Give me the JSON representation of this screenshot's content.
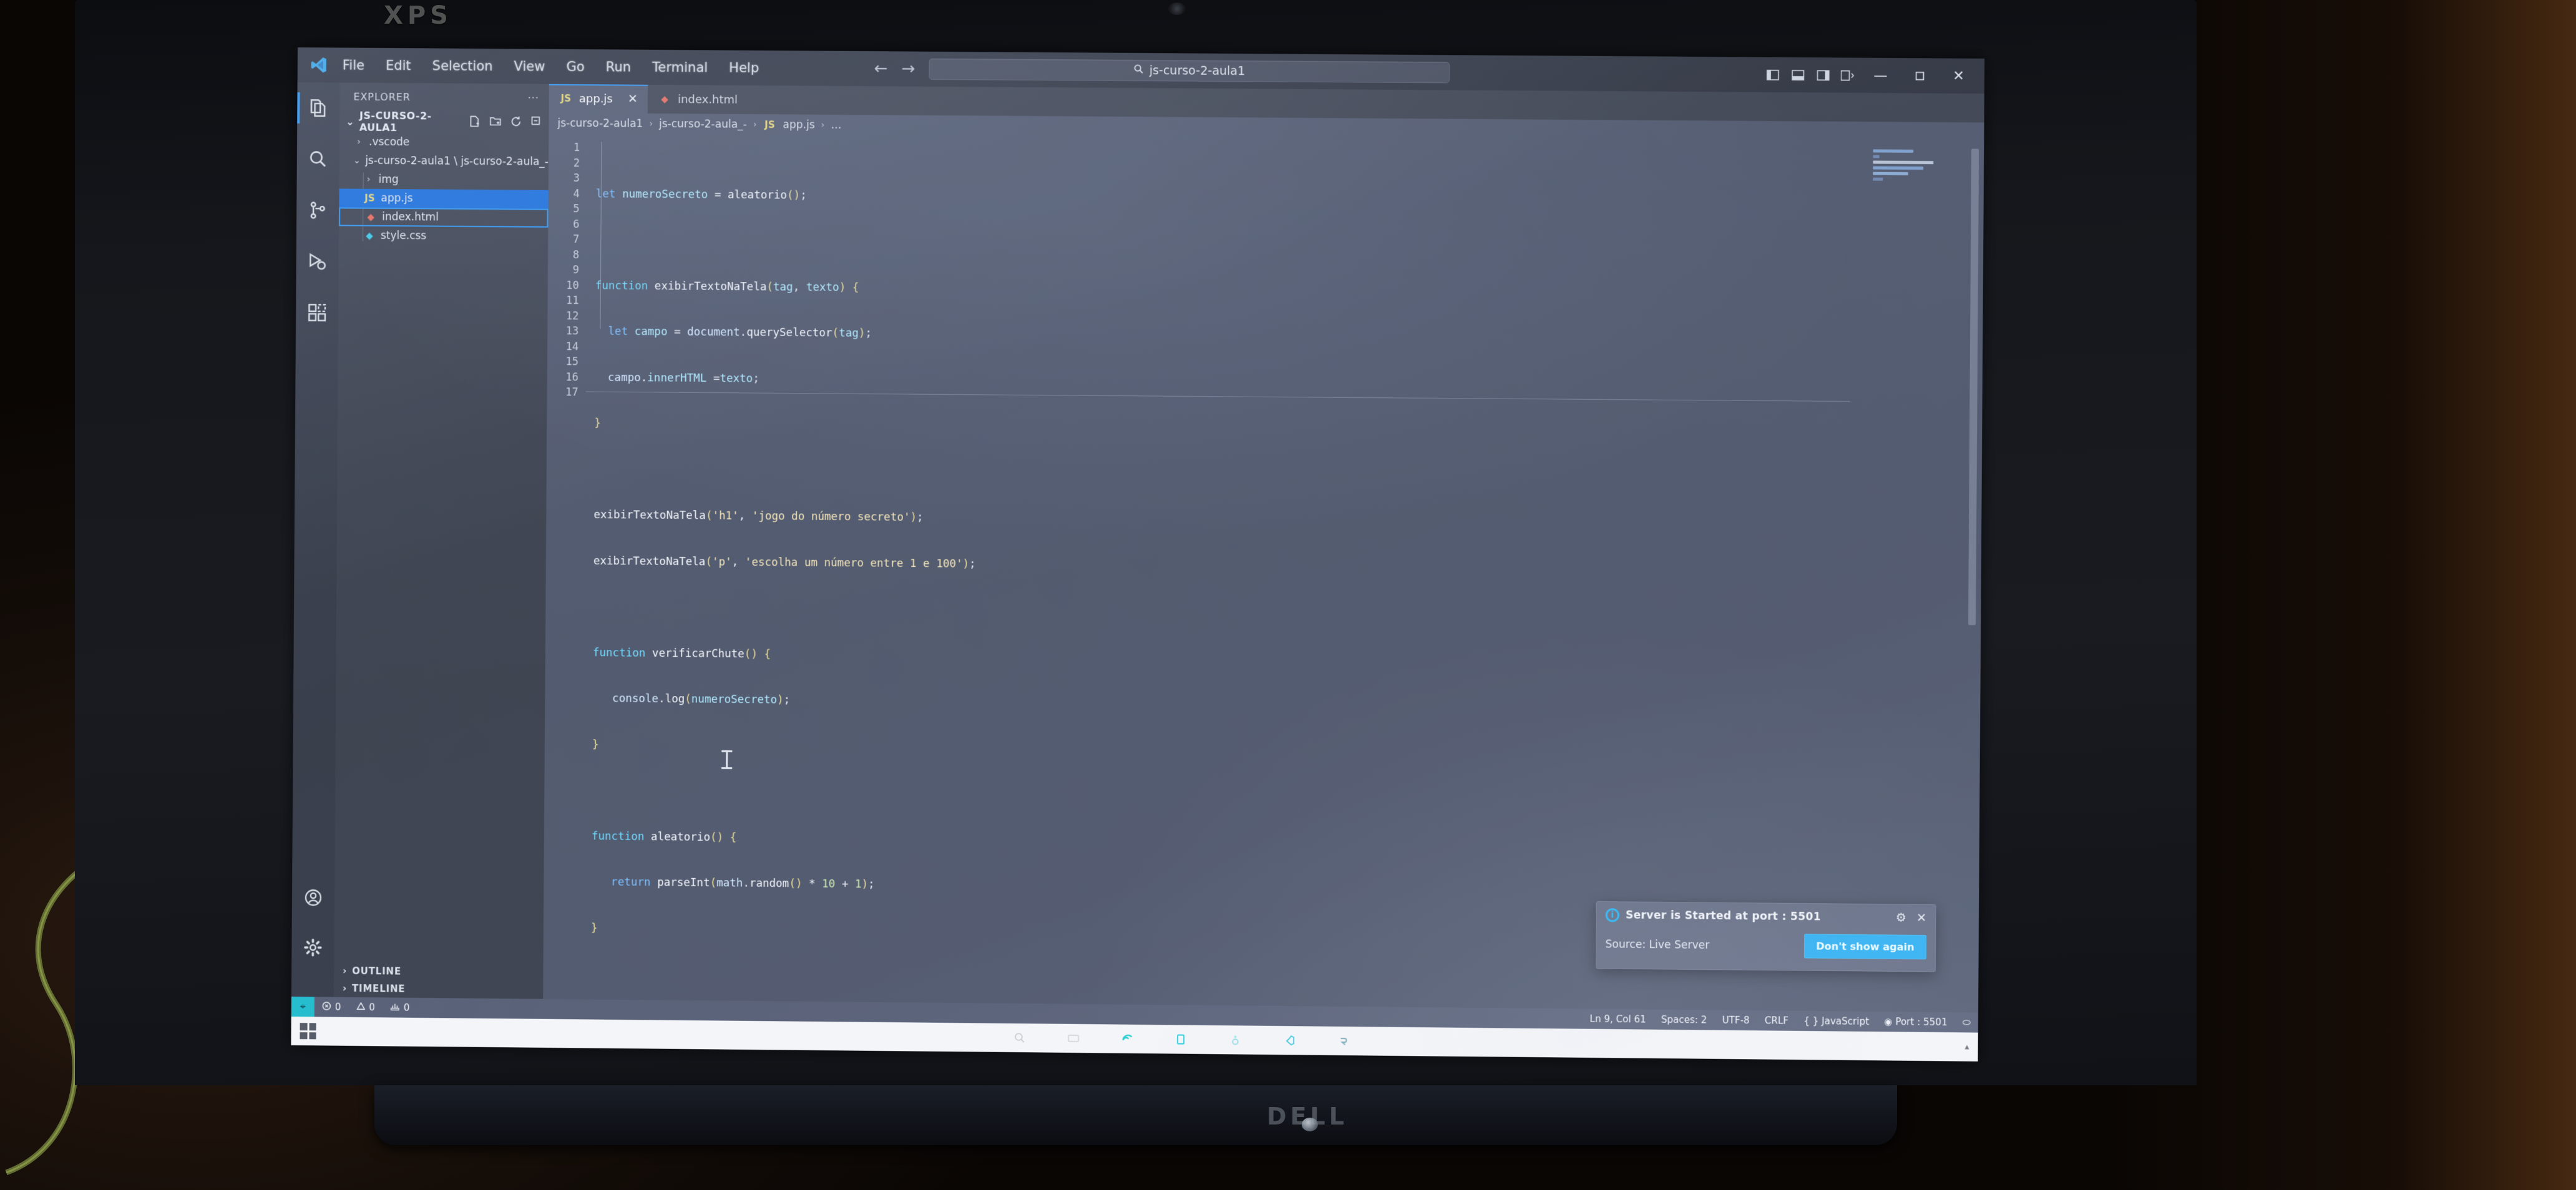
{
  "hardware": {
    "lid_brand": "XPS",
    "chin_brand": "DELL"
  },
  "titlebar": {
    "app_icon": "vscode-logo-icon",
    "menus": [
      "File",
      "Edit",
      "Selection",
      "View",
      "Go",
      "Run",
      "Terminal",
      "Help"
    ],
    "nav_back": "←",
    "nav_forward": "→",
    "command_center_value": "js-curso-2-aula1",
    "command_center_icon": "search-icon",
    "layout_buttons": [
      "toggle-primary-sidebar-icon",
      "toggle-panel-icon",
      "toggle-secondary-sidebar-icon",
      "customize-layout-icon"
    ],
    "window_minimize": "—",
    "window_maximize": "❐",
    "window_close": "✕"
  },
  "activitybar": {
    "items": [
      {
        "name": "explorer",
        "icon": "files-icon",
        "active": true
      },
      {
        "name": "search",
        "icon": "search-icon",
        "active": false
      },
      {
        "name": "source-control",
        "icon": "source-control-icon",
        "active": false
      },
      {
        "name": "run-and-debug",
        "icon": "run-debug-icon",
        "active": false
      },
      {
        "name": "extensions",
        "icon": "extensions-icon",
        "active": false
      }
    ],
    "bottom": [
      {
        "name": "accounts",
        "icon": "account-icon"
      },
      {
        "name": "manage",
        "icon": "gear-icon"
      }
    ]
  },
  "sidebar": {
    "header_title": "EXPLORER",
    "header_more": "···",
    "root_label": "JS-CURSO-2-AULA1",
    "root_chevron": "⌄",
    "root_actions": [
      "new-file-icon",
      "new-folder-icon",
      "refresh-icon",
      "collapse-all-icon"
    ],
    "tree": [
      {
        "label": ".vscode",
        "type": "folder",
        "chevron": "›",
        "depth": 1,
        "state": "normal"
      },
      {
        "label": "js-curso-2-aula1 \\ js-curso-2-aula_-",
        "type": "folder",
        "chevron": "⌄",
        "depth": 1,
        "state": "normal"
      },
      {
        "label": "img",
        "type": "folder",
        "chevron": "›",
        "depth": 2,
        "state": "normal"
      },
      {
        "label": "app.js",
        "type": "js",
        "icon_text": "JS",
        "depth": 2,
        "state": "selected"
      },
      {
        "label": "index.html",
        "type": "html",
        "icon_text": "◆",
        "depth": 2,
        "state": "focused"
      },
      {
        "label": "style.css",
        "type": "css",
        "icon_text": "◆",
        "depth": 2,
        "state": "normal"
      }
    ],
    "sections": [
      {
        "label": "OUTLINE",
        "chevron": "›"
      },
      {
        "label": "TIMELINE",
        "chevron": "›"
      }
    ]
  },
  "editor": {
    "tabs": [
      {
        "label": "app.js",
        "icon_text": "JS",
        "icon_kind": "js",
        "active": true,
        "close": "✕"
      },
      {
        "label": "index.html",
        "icon_text": "◆",
        "icon_kind": "html",
        "active": false,
        "close": ""
      }
    ],
    "breadcrumb": [
      "js-curso-2-aula1",
      "js-curso-2-aula_-",
      "app.js",
      "…"
    ],
    "breadcrumb_file_icon": "JS",
    "breadcrumb_sep": "›",
    "line_numbers": [
      1,
      2,
      3,
      4,
      5,
      6,
      7,
      8,
      9,
      10,
      11,
      12,
      13,
      14,
      15,
      16,
      17
    ],
    "code_lines": [
      "let numeroSecreto = aleatorio();",
      "",
      "function exibirTextoNaTela(tag, texto) {",
      "    let campo = document.querySelector(tag);",
      "    campo.innerHTML =texto;",
      "}",
      "",
      "exibirTextoNaTela('h1', 'jogo do número secreto');",
      "exibirTextoNaTela('p', 'escolha um número entre 1 e 100');",
      "",
      "function verificarChute() {",
      "    console.log(numeroSecreto);",
      "}",
      "",
      "function aleatorio() {",
      "    return parseInt(math.random() * 10 + 1);",
      "}"
    ]
  },
  "toast": {
    "icon": "info-icon",
    "title": "Server is Started at port : 5501",
    "source_label": "Source: Live Server",
    "gear": "⚙",
    "close": "✕",
    "button_label": "Don't show again"
  },
  "statusbar": {
    "remote_label": "⌖",
    "problems": [
      {
        "icon": "error-icon",
        "count": "0"
      },
      {
        "icon": "warning-icon",
        "count": "0"
      },
      {
        "icon": "ports-icon",
        "count": "0"
      }
    ],
    "right_items": [
      {
        "name": "cursor-position",
        "label": "Ln 9, Col 61"
      },
      {
        "name": "indentation",
        "label": "Spaces: 2"
      },
      {
        "name": "encoding",
        "label": "UTF-8"
      },
      {
        "name": "eol",
        "label": "CRLF"
      },
      {
        "name": "language-mode",
        "label": "{ } JavaScript"
      },
      {
        "name": "live-server-port",
        "label": "◉ Port : 5501"
      },
      {
        "name": "notifications",
        "label": "⬭"
      }
    ]
  },
  "taskbar": {
    "start_icon": "windows-start-icon",
    "icons": [
      "search-icon",
      "task-view-icon",
      "edge-icon",
      "file-explorer-icon",
      "chrome-icon",
      "vscode-icon",
      "app-icon"
    ],
    "tray": "▴"
  },
  "colors": {
    "accent_blue": "#1f8ef5",
    "selection_blue": "#0b64d8",
    "remote_teal": "#14b8c8",
    "toast_button": "#1fa8f0",
    "js_yellow": "#e3d26a",
    "html_orange": "#e8604a",
    "css_blue": "#2fc6e8"
  }
}
